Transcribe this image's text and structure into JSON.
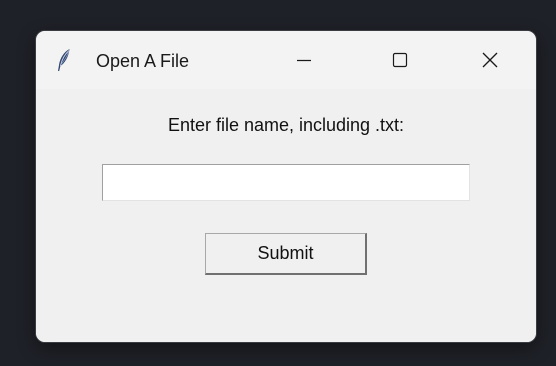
{
  "window": {
    "title": "Open A File",
    "icon": "feather-icon",
    "controls": {
      "minimize": "minimize-icon",
      "maximize": "maximize-icon",
      "close": "close-icon"
    }
  },
  "form": {
    "prompt": "Enter file name, including .txt:",
    "input_value": "",
    "submit_label": "Submit"
  },
  "colors": {
    "desktop": "#1f2128",
    "window_bg": "#f0f0f0",
    "titlebar_bg": "#f3f3f3",
    "text": "#111111",
    "feather_dark": "#2b3a5a",
    "feather_light": "#8aa0c8"
  }
}
